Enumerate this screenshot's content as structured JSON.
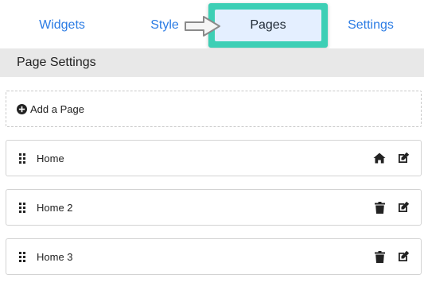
{
  "tabs": [
    {
      "label": "Widgets"
    },
    {
      "label": "Style"
    },
    {
      "label": "Pages"
    },
    {
      "label": "Settings"
    }
  ],
  "active_tab": "Pages",
  "section": {
    "title": "Page Settings"
  },
  "add_page": {
    "label": "Add a Page",
    "icon": "plus-circle-icon"
  },
  "pages": [
    {
      "name": "Home",
      "primary_icon": "home-icon",
      "secondary_icon": "edit-icon"
    },
    {
      "name": "Home 2",
      "primary_icon": "trash-icon",
      "secondary_icon": "edit-icon"
    },
    {
      "name": "Home 3",
      "primary_icon": "trash-icon",
      "secondary_icon": "edit-icon"
    }
  ],
  "colors": {
    "tab_text": "#2a7be4",
    "highlight_border": "#3dcfb5",
    "active_tab_bg": "#e4efff",
    "section_bg": "#e8e8e8"
  }
}
